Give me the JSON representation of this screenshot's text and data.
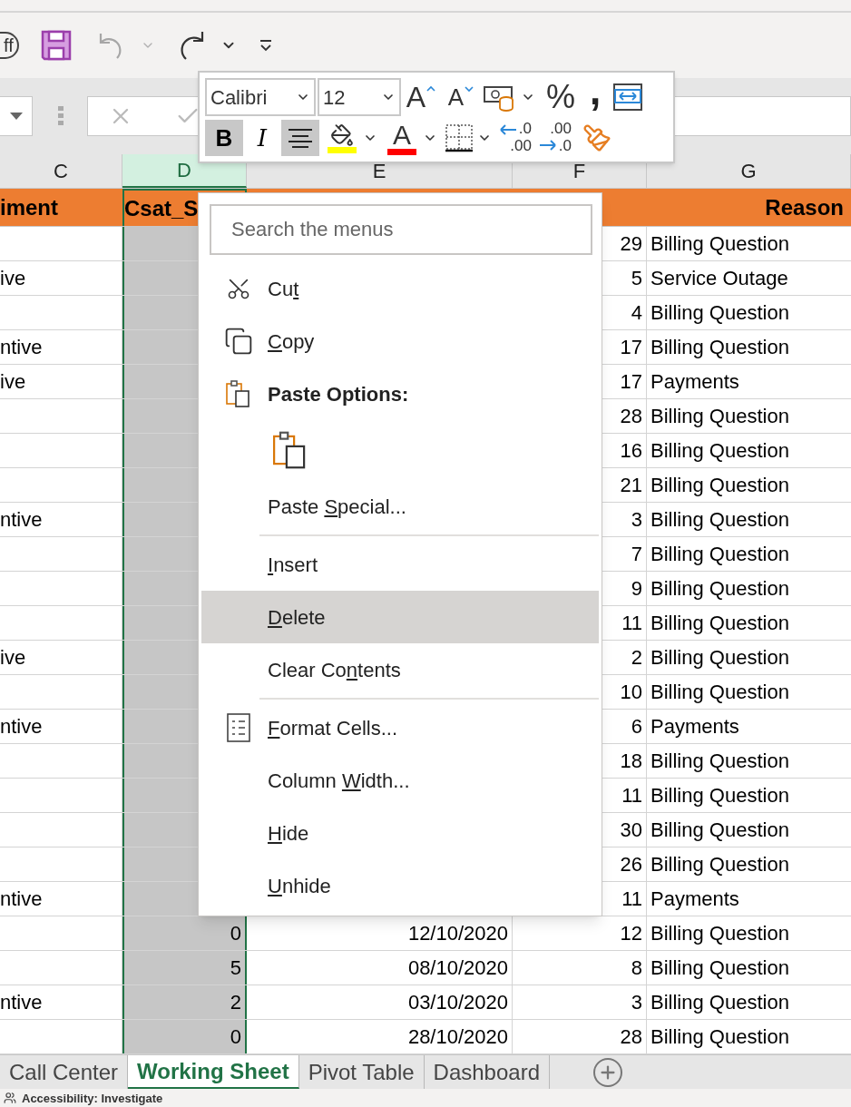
{
  "quick_access": {
    "autosave": {
      "label": "ff"
    },
    "undo": {
      "disabled": true
    }
  },
  "column_headers": [
    {
      "label": "C",
      "selected": false
    },
    {
      "label": "D",
      "selected": true
    },
    {
      "label": "E",
      "selected": false
    },
    {
      "label": "F",
      "selected": false
    },
    {
      "label": "G",
      "selected": false
    }
  ],
  "header_row": {
    "c": "iment",
    "d": "Csat_S",
    "g": "Reason"
  },
  "rows": [
    {
      "c": "",
      "f": "29",
      "g": "Billing Question"
    },
    {
      "c": "ive",
      "f": "5",
      "g": "Service Outage"
    },
    {
      "c": "",
      "f": "4",
      "g": "Billing Question"
    },
    {
      "c": "ntive",
      "f": "17",
      "g": "Billing Question"
    },
    {
      "c": "ive",
      "f": "17",
      "g": "Payments"
    },
    {
      "c": "",
      "f": "28",
      "g": "Billing Question"
    },
    {
      "c": "",
      "f": "16",
      "g": "Billing Question"
    },
    {
      "c": "",
      "f": "21",
      "g": "Billing Question"
    },
    {
      "c": "ntive",
      "f": "3",
      "g": "Billing Question"
    },
    {
      "c": "",
      "f": "7",
      "g": "Billing Question"
    },
    {
      "c": "",
      "f": "9",
      "g": "Billing Question"
    },
    {
      "c": "",
      "f": "11",
      "g": "Billing Question"
    },
    {
      "c": "ive",
      "f": "2",
      "g": "Billing Question"
    },
    {
      "c": "",
      "f": "10",
      "g": "Billing Question"
    },
    {
      "c": "ntive",
      "f": "6",
      "g": "Payments"
    },
    {
      "c": "",
      "f": "18",
      "g": "Billing Question"
    },
    {
      "c": "",
      "f": "11",
      "g": "Billing Question"
    },
    {
      "c": "",
      "f": "30",
      "g": "Billing Question"
    },
    {
      "c": "",
      "f": "26",
      "g": "Billing Question"
    },
    {
      "c": "ntive",
      "f": "11",
      "g": "Payments"
    },
    {
      "c": "",
      "d": "0",
      "e": "12/10/2020",
      "f": "12",
      "g": "Billing Question"
    },
    {
      "c": "",
      "d": "5",
      "e": "08/10/2020",
      "f": "8",
      "g": "Billing Question"
    },
    {
      "c": "ntive",
      "d": "2",
      "e": "03/10/2020",
      "f": "3",
      "g": "Billing Question"
    },
    {
      "c": "",
      "d": "0",
      "e": "28/10/2020",
      "f": "28",
      "g": "Billing Question"
    }
  ],
  "mini_toolbar": {
    "font": {
      "value": "Calibri"
    },
    "size": {
      "value": "12"
    },
    "row1": [
      {
        "kind": "grow",
        "glyph": "A"
      },
      {
        "kind": "shrink",
        "glyph": "A"
      },
      {
        "kind": "accounting"
      },
      {
        "kind": "dropdown"
      },
      {
        "kind": "glyph",
        "glyph": "%"
      },
      {
        "kind": "comma",
        "glyph": ","
      },
      {
        "kind": "wrap"
      }
    ],
    "row2": [
      {
        "kind": "bold",
        "glyph": "B",
        "pressed": true
      },
      {
        "kind": "italic",
        "glyph": "I",
        "pressed": false
      },
      {
        "kind": "center",
        "pressed": true
      },
      {
        "kind": "fill",
        "color": "#ffff00"
      },
      {
        "kind": "dropdown"
      },
      {
        "kind": "font-color",
        "glyph": "A",
        "color": "#ff0000"
      },
      {
        "kind": "dropdown"
      },
      {
        "kind": "borders"
      },
      {
        "kind": "dropdown"
      },
      {
        "kind": "inc-decimal",
        "top": ".0",
        "bottom": ".00"
      },
      {
        "kind": "dec-decimal",
        "top": ".00",
        "bottom": ".0"
      },
      {
        "kind": "painter"
      }
    ]
  },
  "context_menu": {
    "search": {
      "placeholder": "Search the menus"
    },
    "items": [
      {
        "kind": "cut",
        "label": {
          "before": "Cu",
          "key": "t"
        },
        "selected": false
      },
      {
        "kind": "copy",
        "label": {
          "key": "C",
          "after": "opy"
        },
        "selected": false
      },
      {
        "kind": "paste-header",
        "label": {
          "before": "Paste Options:"
        },
        "selected": false
      },
      {
        "kind": "paste-option"
      },
      {
        "kind": "command",
        "label": {
          "before": "Paste ",
          "key": "S",
          "after": "pecial..."
        },
        "selected": false
      },
      {
        "kind": "separator"
      },
      {
        "kind": "command",
        "label": {
          "key": "I",
          "after": "nsert"
        },
        "selected": false
      },
      {
        "kind": "command",
        "label": {
          "key": "D",
          "after": "elete"
        },
        "selected": true
      },
      {
        "kind": "command",
        "label": {
          "before": "Clear Co",
          "key": "n",
          "after": "tents"
        },
        "selected": false
      },
      {
        "kind": "separator"
      },
      {
        "kind": "format",
        "label": {
          "key": "F",
          "after": "ormat Cells..."
        },
        "selected": false
      },
      {
        "kind": "command",
        "label": {
          "before": "Column ",
          "key": "W",
          "after": "idth..."
        },
        "selected": false
      },
      {
        "kind": "command",
        "label": {
          "key": "H",
          "after": "ide"
        },
        "selected": false
      },
      {
        "kind": "command",
        "label": {
          "key": "U",
          "after": "nhide"
        },
        "selected": false
      }
    ]
  },
  "sheet_tabs": [
    {
      "label": "Call Center",
      "selected": false
    },
    {
      "label": "Working Sheet",
      "selected": true
    },
    {
      "label": "Pivot Table",
      "selected": false
    },
    {
      "label": "Dashboard",
      "selected": false
    }
  ],
  "status_bar": {
    "text": "Accessibility: Investigate"
  }
}
